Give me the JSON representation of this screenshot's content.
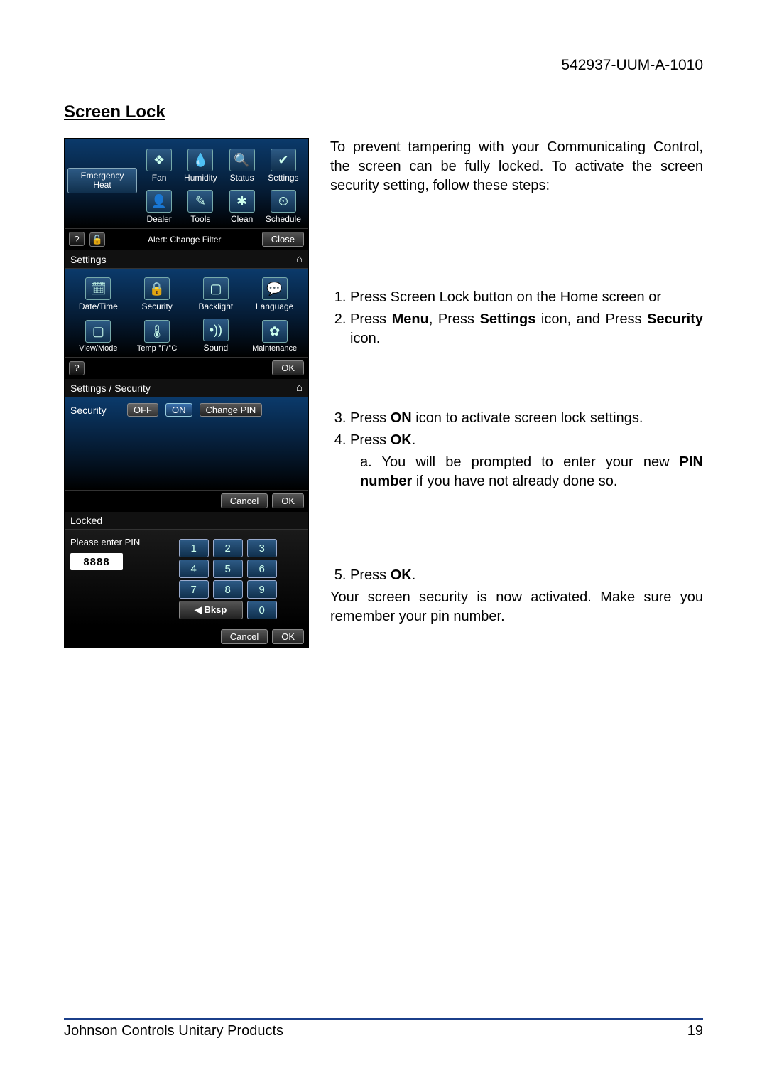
{
  "doc_id": "542937-UUM-A-1010",
  "section_title": "Screen Lock",
  "intro": "To prevent tampering with your Communicating Control, the screen can be fully locked. To activate the screen security setting, follow these steps:",
  "step1": "Press Screen Lock button on the Home screen or",
  "step2_pre": "Press ",
  "step2_b1": "Menu",
  "step2_mid": ", Press ",
  "step2_b2": "Settings",
  "step2_mid2": " icon, and Press ",
  "step2_b3": "Security",
  "step2_post": " icon.",
  "step3_pre": "Press ",
  "step3_b": "ON",
  "step3_post": " icon to activate screen lock settings.",
  "step4_pre": "Press ",
  "step4_b": "OK",
  "step4_post": ".",
  "step4a_pre": "a. You will be prompted to enter your new ",
  "step4a_b": "PIN number",
  "step4a_post": " if you have not already done so.",
  "step5_pre": "Press ",
  "step5_b": "OK",
  "step5_post": ".",
  "closing": "Your screen security is now activated. Make sure you remember your pin number.",
  "footer_left": "Johnson Controls Unitary Products",
  "footer_right": "19",
  "s1": {
    "emergency": "Emergency Heat",
    "icons_row1": [
      "Fan",
      "Humidity",
      "Status",
      "Settings"
    ],
    "icons_row2": [
      "Dealer",
      "Tools",
      "Clean",
      "Schedule"
    ],
    "glyphs_row1": [
      "❖",
      "💧",
      "🔍",
      "✔"
    ],
    "glyphs_row2": [
      "👤",
      "✎",
      "✱",
      "⏲"
    ],
    "alert": "Alert: Change Filter",
    "close": "Close"
  },
  "s2": {
    "title": "Settings",
    "icons_row1": [
      "Date/Time",
      "Security",
      "Backlight",
      "Language"
    ],
    "icons_row2": [
      "View/Mode",
      "Temp °F/°C",
      "Sound",
      "Maintenance"
    ],
    "glyphs_row1": [
      "🗓",
      "🔒",
      "▢",
      "💬"
    ],
    "glyphs_row2": [
      "▢",
      "🌡",
      "•))",
      "✿"
    ],
    "ok": "OK"
  },
  "s3": {
    "title": "Settings / Security",
    "security": "Security",
    "off": "OFF",
    "on": "ON",
    "change_pin": "Change PIN",
    "cancel": "Cancel",
    "ok": "OK"
  },
  "s4": {
    "title": "Locked",
    "prompt": "Please enter PIN",
    "pin": "8888",
    "keys": [
      "1",
      "2",
      "3",
      "4",
      "5",
      "6",
      "7",
      "8",
      "9"
    ],
    "bksp": "◀ Bksp",
    "zero": "0",
    "cancel": "Cancel",
    "ok": "OK"
  }
}
